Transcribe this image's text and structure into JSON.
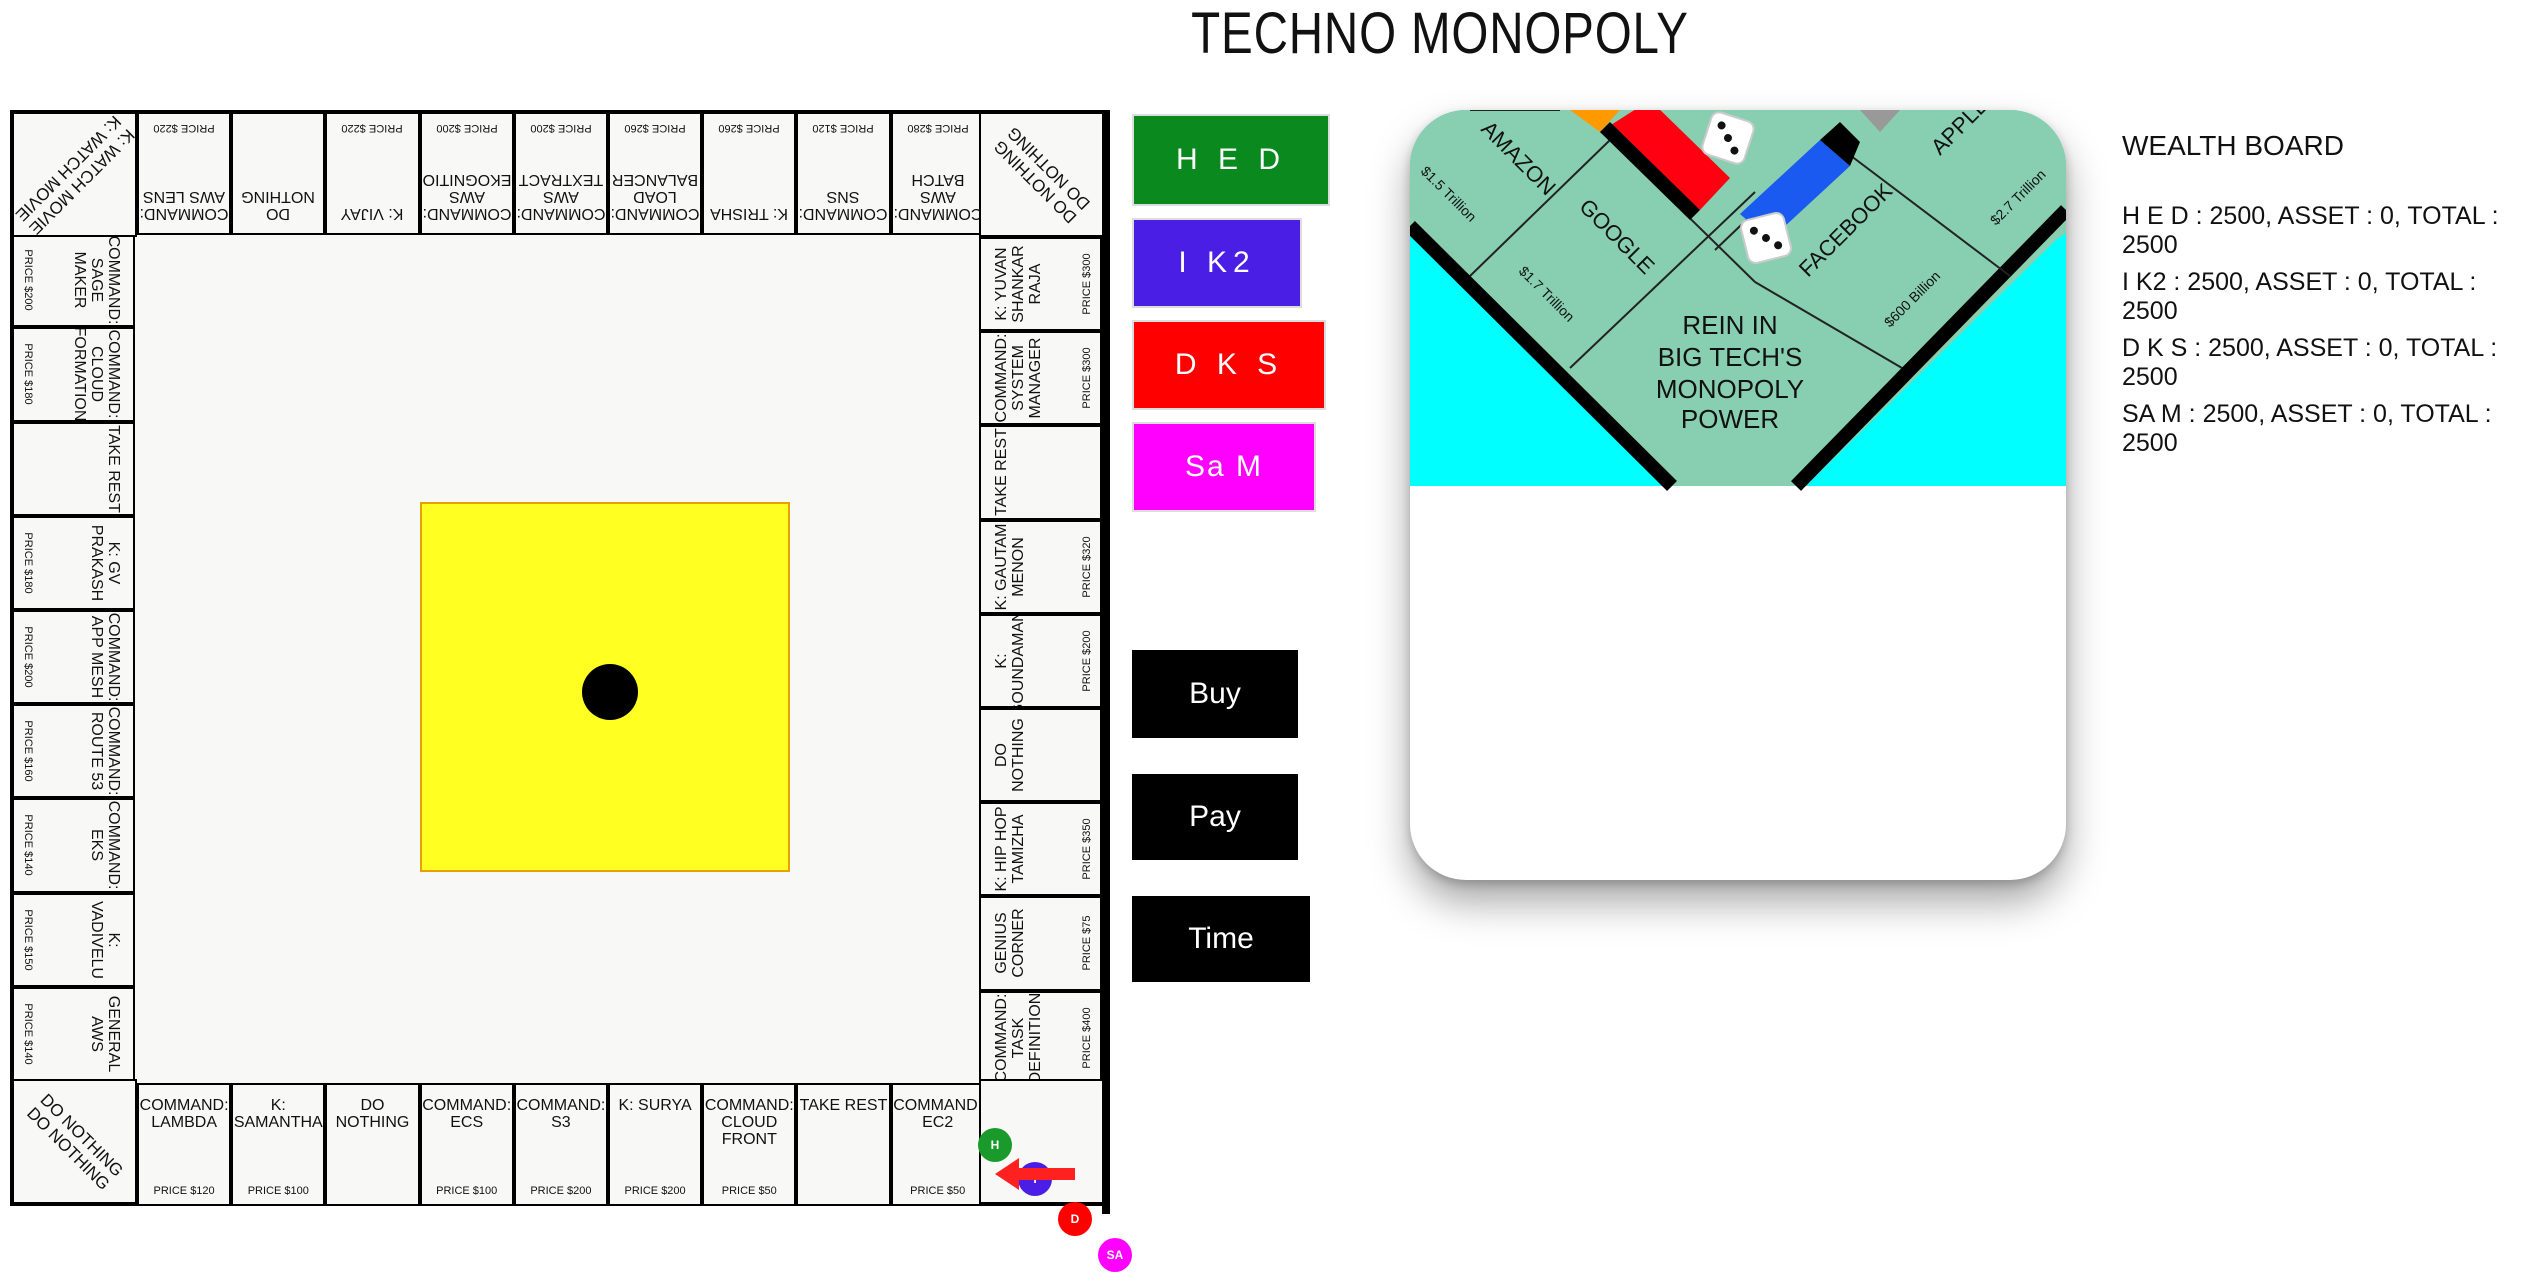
{
  "app_title": "TECHNO MONOPOLY",
  "board": {
    "bottom": [
      {
        "name": "Command: Lambda",
        "price": "Price $120"
      },
      {
        "name": "K: Samantha",
        "price": "Price $100"
      },
      {
        "name": "Do Nothing",
        "price": ""
      },
      {
        "name": "Command: ECS",
        "price": "Price $100"
      },
      {
        "name": "Command: S3",
        "price": "Price $200"
      },
      {
        "name": "K: Surya",
        "price": "Price $200"
      },
      {
        "name": "Command: Cloud Front",
        "price": "Price $50"
      },
      {
        "name": "Take Rest",
        "price": ""
      },
      {
        "name": "Command: EC2",
        "price": "Price $50"
      }
    ],
    "left": [
      {
        "name": "General AWS",
        "price": "Price $140"
      },
      {
        "name": "K: Vadivelu",
        "price": "Price $150"
      },
      {
        "name": "Command: EKS",
        "price": "Price $140"
      },
      {
        "name": "Command: Route 53",
        "price": "Price $160"
      },
      {
        "name": "Command: App Mesh",
        "price": "Price $200"
      },
      {
        "name": "K: GV Prakash",
        "price": "Price $180"
      },
      {
        "name": "Take Rest",
        "price": ""
      },
      {
        "name": "Command: Cloud Formation",
        "price": "Price $180"
      },
      {
        "name": "Command: Sage Maker",
        "price": "Price $200"
      }
    ],
    "top": [
      {
        "name": "Command: AWS Lens",
        "price": "Price $220"
      },
      {
        "name": "Do Nothing",
        "price": ""
      },
      {
        "name": "K: Vijay",
        "price": "Price $220"
      },
      {
        "name": "Command: AWS Rekognition",
        "price": "Price $200"
      },
      {
        "name": "Command: AWS Textract",
        "price": "Price $200"
      },
      {
        "name": "Command: Load Balancer",
        "price": "Price $260"
      },
      {
        "name": "K: Trisha",
        "price": "Price $260"
      },
      {
        "name": "Command: SNS",
        "price": "Price $120"
      },
      {
        "name": "Command: AWS Batch",
        "price": "Price $280"
      }
    ],
    "right": [
      {
        "name": "K: Yuvan Shankar Raja",
        "price": "Price $300"
      },
      {
        "name": "Command: System Manager",
        "price": "Price $300"
      },
      {
        "name": "Take Rest",
        "price": ""
      },
      {
        "name": "K: Gautam Menon",
        "price": "Price $320"
      },
      {
        "name": "K: Goundamani",
        "price": "Price $200"
      },
      {
        "name": "Do Nothing",
        "price": ""
      },
      {
        "name": "K: Hip Hop Tamizha",
        "price": "Price $350"
      },
      {
        "name": "Genius Corner",
        "price": "Price $75"
      },
      {
        "name": "Command: Task Definition",
        "price": "Price $400"
      }
    ],
    "corners": {
      "bottom_left": "Do Nothing\nDo Nothing",
      "top_left": "K: Watch Movie\nK: Watch Movie",
      "top_right": "Do Nothing\nDo Nothing"
    },
    "tokens": [
      {
        "label": "H",
        "color": "#1a9a2a"
      },
      {
        "label": "I",
        "color": "#4b1ee6"
      },
      {
        "label": "D",
        "color": "#ff0000"
      },
      {
        "label": "SA",
        "color": "#ff00ff"
      }
    ],
    "die_color": "#ffff22"
  },
  "players": [
    {
      "label": "H E D",
      "color": "#0a8a1e"
    },
    {
      "label": "I K2",
      "color": "#4b1ee6"
    },
    {
      "label": "D K S",
      "color": "#ff0000"
    },
    {
      "label": "Sa M",
      "color": "#ff00ff"
    }
  ],
  "actions": {
    "buy": "Buy",
    "pay": "Pay",
    "time": "Time"
  },
  "card": {
    "headline_1": "REIN IN",
    "headline_2": "BIG TECH'S",
    "headline_3": "MONOPOLY",
    "headline_4": "POWER",
    "amazon": "AMAZON",
    "amazon_value": "$1.5 Trillion",
    "google": "GOOGLE",
    "google_value": "$1.7 Trillion",
    "facebook": "FACEBOOK",
    "facebook_value": "$600 Billion",
    "apple": "APPLE",
    "apple_value": "$2.7 Trillion"
  },
  "wealth": {
    "title": "WEALTH BOARD",
    "lines": [
      "H E D : 2500, ASSET : 0, TOTAL : 2500",
      "I K2 : 2500, ASSET : 0, TOTAL : 2500",
      "D K S : 2500, ASSET : 0, TOTAL : 2500",
      "SA M : 2500, ASSET : 0, TOTAL : 2500"
    ]
  }
}
